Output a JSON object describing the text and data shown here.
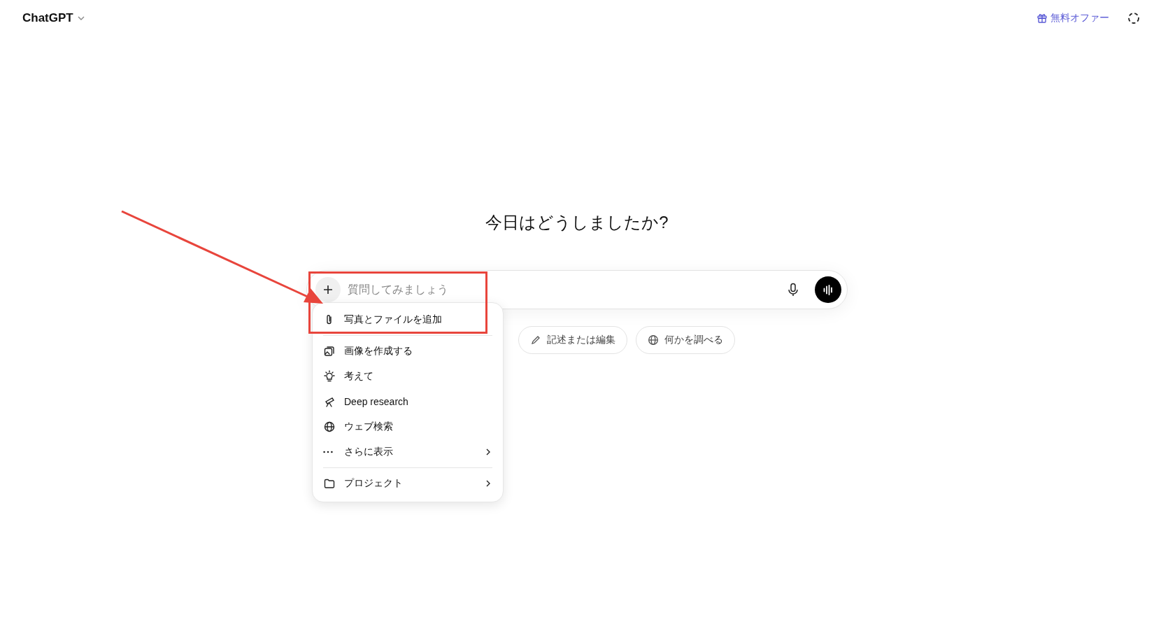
{
  "header": {
    "model": "ChatGPT",
    "offer": "無料オファー"
  },
  "heading": "今日はどうしましたか?",
  "composer": {
    "placeholder": "質問してみましょう"
  },
  "chips": [
    {
      "label": "記述または編集"
    },
    {
      "label": "何かを調べる"
    }
  ],
  "menu": {
    "sections": [
      [
        {
          "label": "写真とファイルを追加",
          "submenu": false
        }
      ],
      [
        {
          "label": "画像を作成する",
          "submenu": false
        },
        {
          "label": "考えて",
          "submenu": false
        },
        {
          "label": "Deep research",
          "submenu": false
        },
        {
          "label": "ウェブ検索",
          "submenu": false
        },
        {
          "label": "さらに表示",
          "submenu": true
        }
      ],
      [
        {
          "label": "プロジェクト",
          "submenu": true
        }
      ]
    ]
  }
}
